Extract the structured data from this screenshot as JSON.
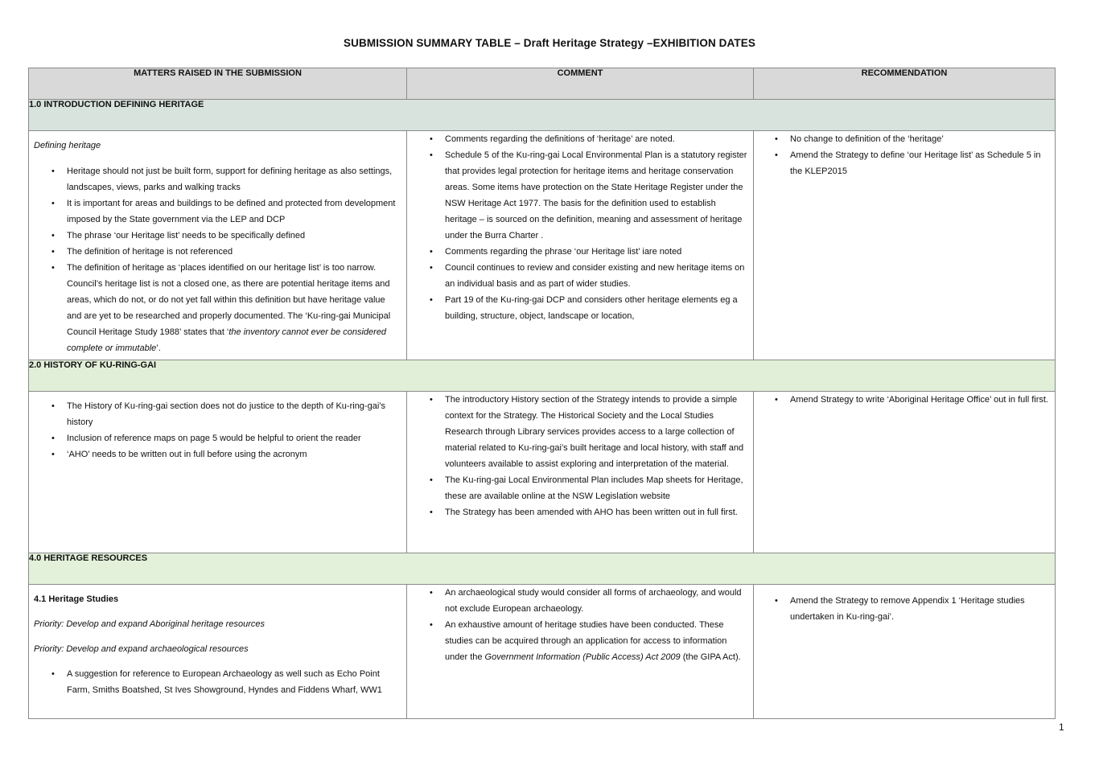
{
  "title": "SUBMISSION SUMMARY TABLE – Draft Heritage Strategy –EXHIBITION DATES",
  "headers": {
    "matters": "MATTERS RAISED IN THE SUBMISSION",
    "comment": "COMMENT",
    "recommendation": "RECOMMENDATION"
  },
  "sections": [
    {
      "heading": "1.0  INTRODUCTION DEFINING HERITAGE",
      "matters_intro": "Defining heritage",
      "matters": [
        "Heritage should not just be built form, support for defining heritage as also settings, landscapes, views, parks and walking tracks",
        "It is important for areas and buildings to be defined and protected from development imposed by the State government via the LEP and DCP",
        "The phrase ‘our Heritage list’ needs to be specifically defined",
        "The definition of heritage is not referenced",
        "The definition of heritage as ‘places identified on our heritage list’ is too narrow. Council’s heritage list is not a closed one, as there are potential heritage items and areas, which do not, or do not yet fall within this definition but have heritage value and are yet to be researched and properly documented. The ‘Ku-ring-gai Municipal Council Heritage Study 1988’ states that ‘",
        "the inventory cannot ever be considered complete or immutable",
        "’."
      ],
      "comments": [
        "Comments regarding the definitions of ‘heritage’ are noted.",
        "Schedule 5 of the Ku-ring-gai Local Environmental Plan is a statutory register that provides legal protection for heritage items and heritage conservation areas. Some items have protection on the State Heritage Register under the NSW Heritage Act 1977. The basis for the definition used to establish  heritage – is sourced on the definition, meaning  and assessment of heritage under the Burra Charter .",
        "Comments regarding the phrase ‘our Heritage list’ iare noted",
        "Council continues to review and consider existing and new heritage items on an individual basis and as part of wider studies.",
        " Part 19 of the Ku-ring-gai DCP and considers other heritage elements eg a building, structure, object, landscape or location,"
      ],
      "recommendations": [
        "No change to definition of the ‘heritage’",
        "Amend the Strategy to define ‘our Heritage list’ as Schedule 5 in the KLEP2015"
      ]
    },
    {
      "heading": "2.0 HISTORY OF KU-RING-GAI",
      "matters": [
        "The History of Ku-ring-gai section does not do justice to the depth of Ku-ring-gai’s history",
        "Inclusion of reference maps on page 5 would be helpful to orient the reader",
        "‘AHO’ needs to be written out in full before using the acronym"
      ],
      "comments": [
        "The introductory History section of the Strategy intends to provide a simple context for the Strategy. The Historical Society and the Local Studies Research through Library services provides access to a large collection of material related to Ku-ring-gai’s built heritage and local history, with staff and volunteers available to assist exploring and interpretation of the material.",
        "The Ku-ring-gai Local Environmental Plan includes Map sheets for Heritage, these are available online at the NSW Legislation website",
        "The Strategy has been amended with AHO has been written out in full first."
      ],
      "recommendations": [
        "Amend Strategy to write ‘Aboriginal Heritage Office’ out in full first."
      ]
    },
    {
      "heading": "4.0 HERITAGE RESOURCES",
      "matters_subheading": "4.1 Heritage Studies",
      "priority_1": "Priority: Develop and expand Aboriginal heritage resources",
      "priority_2": "Priority: Develop and expand archaeological resources",
      "matters": [
        "A suggestion for reference to European Archaeology as well such as Echo Point Farm, Smiths Boatshed, St Ives Showground, Hyndes and Fiddens Wharf, WW1"
      ],
      "comments": [
        "An archaeological study would consider all forms of archaeology, and would not exclude European archaeology.",
        "An exhaustive amount of heritage studies have been conducted. These studies can be acquired through an application for access to information under the ",
        "Government Information (Public Access) Act 2009",
        " (the GIPA Act)."
      ],
      "recommendations": [
        "Amend the Strategy to remove Appendix 1 ‘Heritage studies undertaken in Ku-ring-gai’."
      ]
    }
  ],
  "page_number": "1"
}
